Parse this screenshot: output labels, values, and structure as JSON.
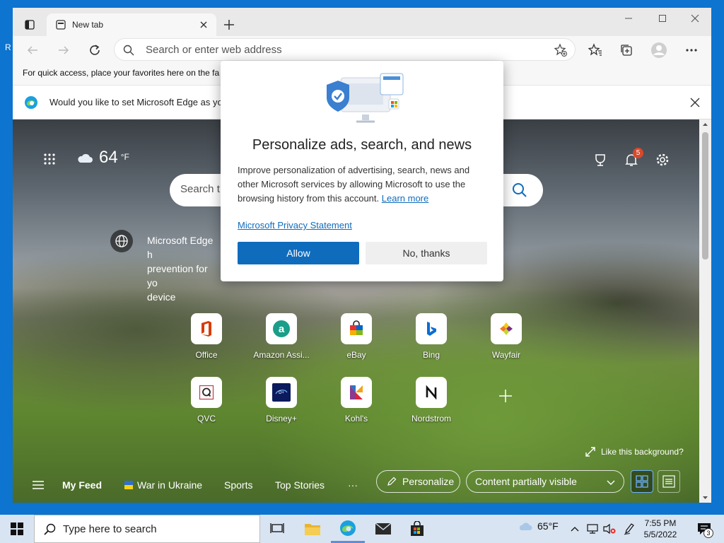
{
  "desktop": {
    "edge_letter": "R"
  },
  "browser": {
    "tab": {
      "title": "New tab"
    },
    "address": {
      "placeholder": "Search or enter web address"
    },
    "favorites_bar_text": "For quick access, place your favorites here on the fa",
    "infobar": {
      "message": "Would you like to set Microsoft Edge as yo"
    }
  },
  "newtab": {
    "weather": {
      "temp": "64",
      "unit": "°F"
    },
    "notifications_count": "5",
    "search_placeholder": "Search t",
    "promo": [
      "Microsoft Edge h",
      "prevention for yo",
      "device"
    ],
    "tiles": [
      {
        "label": "Office",
        "icon": "office-icon"
      },
      {
        "label": "Amazon Assi...",
        "icon": "amazon-icon"
      },
      {
        "label": "eBay",
        "icon": "ebay-icon"
      },
      {
        "label": "Bing",
        "icon": "bing-icon"
      },
      {
        "label": "Wayfair",
        "icon": "wayfair-icon"
      },
      {
        "label": "QVC",
        "icon": "qvc-icon"
      },
      {
        "label": "Disney+",
        "icon": "disney-icon"
      },
      {
        "label": "Kohl's",
        "icon": "kohls-icon"
      },
      {
        "label": "Nordstrom",
        "icon": "nordstrom-icon"
      }
    ],
    "like_background": "Like this background?",
    "feed": {
      "my_feed": "My Feed",
      "war": "War in Ukraine",
      "sports": "Sports",
      "top_stories": "Top Stories",
      "more": "···",
      "personalize": "Personalize",
      "visibility": "Content partially visible"
    }
  },
  "dialog": {
    "title": "Personalize ads, search, and news",
    "body": "Improve personalization of advertising, search, news and other Microsoft services by allowing Microsoft to use the browsing history from this account.",
    "learn_more": "Learn more",
    "privacy": "Microsoft Privacy Statement",
    "allow": "Allow",
    "no_thanks": "No, thanks"
  },
  "taskbar": {
    "search_placeholder": "Type here to search",
    "weather": "65°F",
    "time": "7:55 PM",
    "date": "5/5/2022",
    "notification_count": "3"
  },
  "colors": {
    "accent": "#0f6cbd",
    "taskbar": "#d9e4f2",
    "desktop": "#0d74cf"
  }
}
